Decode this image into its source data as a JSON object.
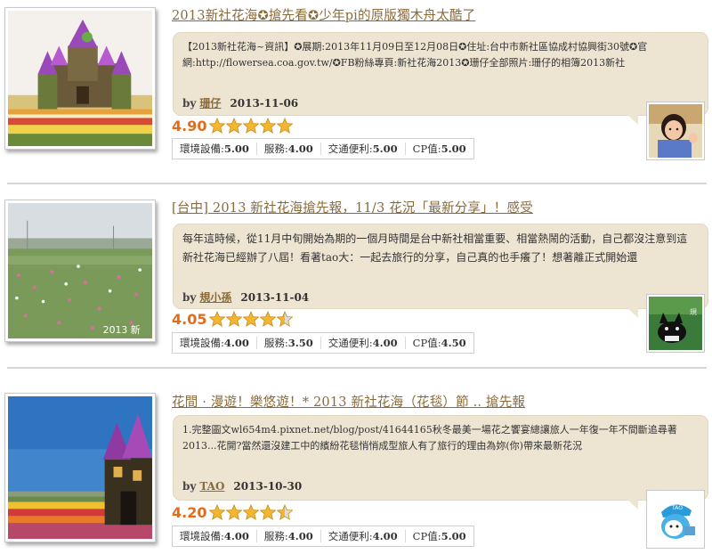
{
  "posts": [
    {
      "title": "2013新社花海✪搶先看✪少年pi的原版獨木舟太酷了",
      "excerpt": "【2013新社花海~資訊】✪展期:2013年11月09日至12月08日✪住址:台中市新社區協成村協興街30號✪官網:http://flowersea.coa.gov.tw/✪FB粉絲專頁:新社花海2013✪珊仔全部照片:珊仔的相簿2013新社",
      "by": "by",
      "author": "珊仔",
      "date": "2013-11-06",
      "score": "4.90",
      "stars": [
        1,
        1,
        1,
        1,
        1
      ],
      "subs": [
        {
          "label": "環境設備:",
          "value": "5.00"
        },
        {
          "label": "服務:",
          "value": "4.00"
        },
        {
          "label": "交通便利:",
          "value": "5.00"
        },
        {
          "label": "CP值:",
          "value": "5.00"
        }
      ],
      "thumb_icon": "flower-castle-photo",
      "avatar_icon": "woman-portrait-avatar"
    },
    {
      "title": "[台中] 2013 新社花海搶先報，11/3 花況「最新分享」！感受",
      "excerpt": "每年這時候，從11月中旬開始為期的一個月時間是台中新社相當重要、相當熱鬧的活動，自己都沒注意到這新社花海已經辦了八屆！看著tao大：一起去旅行的分享，自己真的也手癢了！想著離正式開始還",
      "by": "by",
      "author": "規小孫",
      "date": "2013-11-04",
      "score": "4.05",
      "stars": [
        1,
        1,
        1,
        1,
        0.5
      ],
      "subs": [
        {
          "label": "環境設備:",
          "value": "4.00"
        },
        {
          "label": "服務:",
          "value": "3.50"
        },
        {
          "label": "交通便利:",
          "value": "4.00"
        },
        {
          "label": "CP值:",
          "value": "4.50"
        }
      ],
      "thumb_watermark": "2013 新",
      "thumb_icon": "flower-field-photo",
      "avatar_icon": "black-cat-avatar"
    },
    {
      "title": "花間 · 漫遊！樂悠遊！* 2013 新社花海（花毯）節 .. 搶先報",
      "excerpt": "1.完整圖文wl654m4.pixnet.net/blog/post/41644165秋冬最美一場花之饗宴總讓旅人一年復一年不間斷追尋著2013...花開?當然還沒建工中的繽紛花毯悄悄成型旅人有了旅行的理由為妳(你)帶來最新花況",
      "by": "by",
      "author": "TAO",
      "date": "2013-10-30",
      "score": "4.20",
      "stars": [
        1,
        1,
        1,
        1,
        0.5
      ],
      "subs": [
        {
          "label": "環境設備:",
          "value": "4.00"
        },
        {
          "label": "服務:",
          "value": "4.00"
        },
        {
          "label": "交通便利:",
          "value": "4.00"
        },
        {
          "label": "CP值:",
          "value": "5.00"
        }
      ],
      "thumb_icon": "castle-sky-photo",
      "avatar_icon": "tao-cartoon-avatar"
    }
  ],
  "colors": {
    "title": "#8a6a3a",
    "bubble": "#ede5d2",
    "score": "#e36b1a",
    "star_fill": "#f2b631",
    "star_empty": "#dddddd"
  }
}
